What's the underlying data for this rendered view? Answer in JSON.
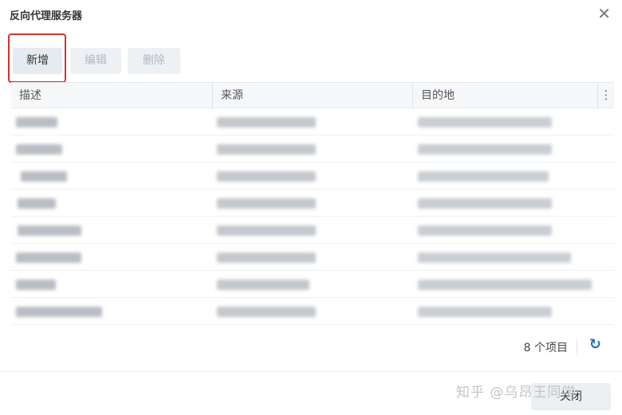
{
  "dialog": {
    "title": "反向代理服务器",
    "close_glyph": "✕"
  },
  "toolbar": {
    "add_label": "新增",
    "edit_label": "编辑",
    "delete_label": "删除"
  },
  "table": {
    "columns": [
      "描述",
      "来源",
      "目的地"
    ],
    "menu_glyph": "⋮"
  },
  "footer": {
    "count_text": "8 个项目",
    "refresh_glyph": "↻"
  },
  "actions": {
    "close_label": "关闭"
  },
  "watermark": "知乎 @乌昂王同学",
  "colors": {
    "accent": "#1a73c8",
    "highlight": "#d9302a"
  },
  "icons": {
    "close": "close-icon",
    "menu": "column-menu-icon",
    "refresh": "refresh-icon"
  }
}
